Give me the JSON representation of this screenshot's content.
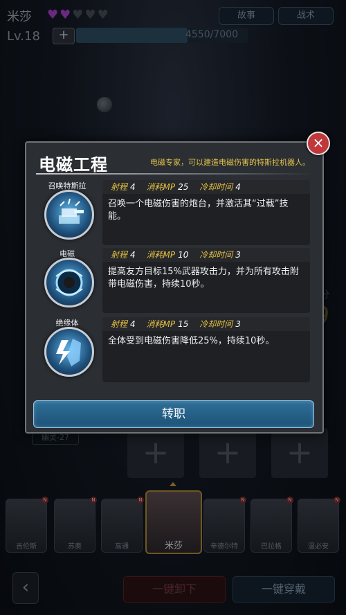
{
  "player": {
    "name": "米莎",
    "level": "Lv.18",
    "xp_text": "4550/7000",
    "xp_progress": 0.65,
    "hearts_filled": 2,
    "hearts_total": 5
  },
  "top_tabs": {
    "story": "故事",
    "tactics": "战术"
  },
  "dialog": {
    "title": "电磁工程",
    "description": "电磁专家，可以建造电磁伤害的特斯拉机器人。",
    "stat_labels": {
      "range": "射程",
      "mp": "消耗MP",
      "cooldown": "冷却时间"
    },
    "skills": [
      {
        "name": "召唤特斯拉",
        "range": "4",
        "mp": "25",
        "cooldown": "4",
        "text": "召唤一个电磁伤害的炮台，并激活其“过载”技能。",
        "icon": "tesla-turret-icon"
      },
      {
        "name": "电磁",
        "range": "4",
        "mp": "10",
        "cooldown": "3",
        "text": "提高友方目标15%武器攻击力，并为所有攻击附带电磁伤害，持续10秒。",
        "icon": "electromagnetic-orb-icon"
      },
      {
        "name": "绝缘体",
        "range": "4",
        "mp": "15",
        "cooldown": "3",
        "text": "全体受到电磁伤害降低25%，持续10秒。",
        "icon": "insulator-shield-icon"
      }
    ],
    "confirm_button": "转职",
    "close": "×"
  },
  "background": {
    "ghost_label": "幽灵-27",
    "score_digit": "9",
    "score_label": "分"
  },
  "roster": [
    {
      "name": "吉伦斯",
      "badge": "N"
    },
    {
      "name": "苏奥",
      "badge": "N"
    },
    {
      "name": "高通",
      "badge": "N"
    },
    {
      "name": "米莎",
      "badge": "",
      "selected": true
    },
    {
      "name": "辛德尔特",
      "badge": "N"
    },
    {
      "name": "巴拉格",
      "badge": "N"
    },
    {
      "name": "温必安",
      "badge": "N"
    }
  ],
  "bottom": {
    "back": "‹",
    "unequip_all": "一键卸下",
    "equip_all": "一键穿戴"
  },
  "colors": {
    "accent_yellow": "#e4c040",
    "confirm_blue": "#2f6f99",
    "close_red": "#c0383b",
    "heart_purple": "#a33fc2"
  }
}
